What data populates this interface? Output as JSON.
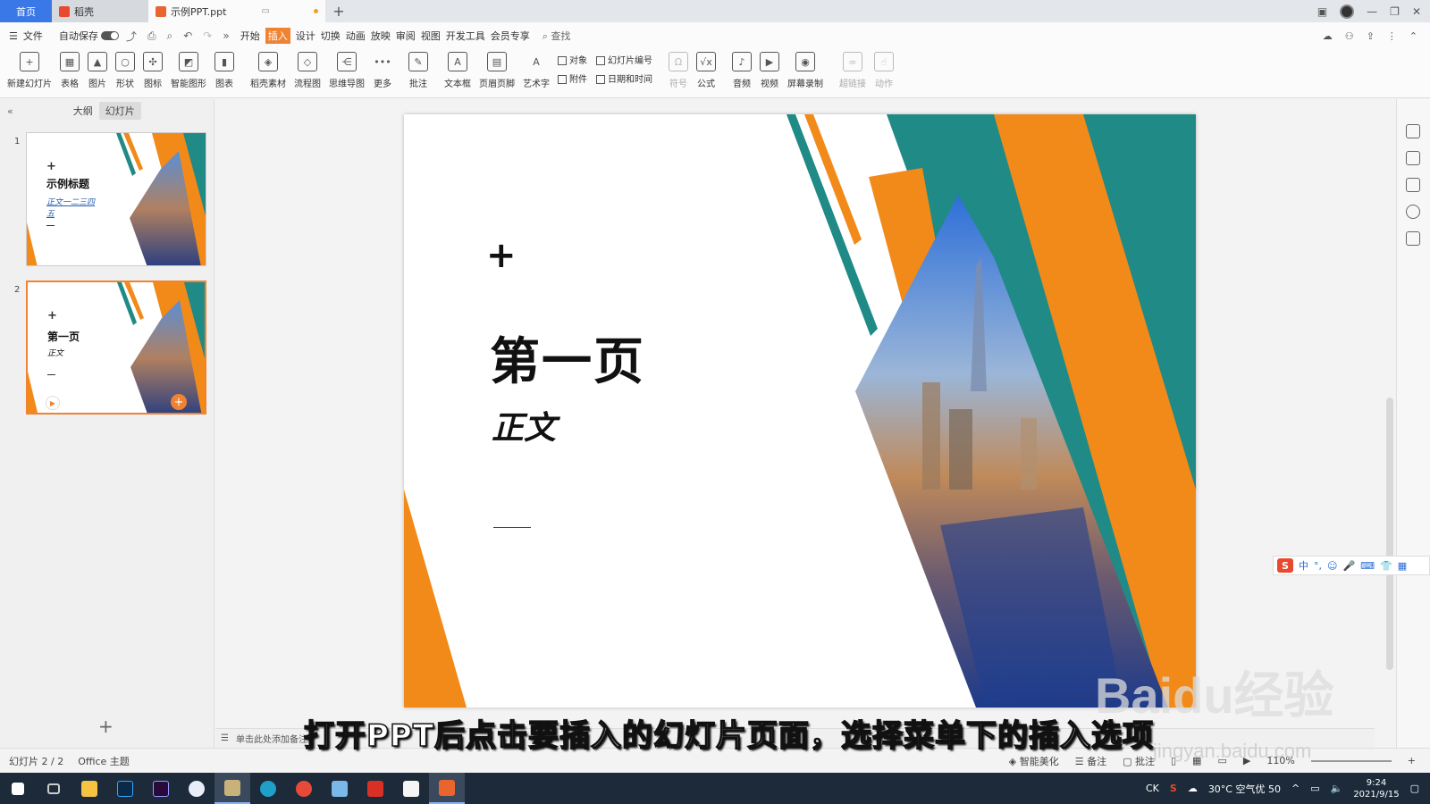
{
  "tabs": {
    "home": "首页",
    "daoke": "稻壳",
    "document": "示例PPT.ppt"
  },
  "menu": {
    "file": "文件",
    "autosave": "自动保存",
    "items": [
      "开始",
      "插入",
      "设计",
      "切换",
      "动画",
      "放映",
      "审阅",
      "视图",
      "开发工具",
      "会员专享"
    ],
    "active_item": "插入",
    "search": "查找"
  },
  "ribbon": {
    "buttons": [
      {
        "label": "新建幻灯片",
        "icon": "new-slide-icon"
      },
      {
        "label": "表格",
        "icon": "table-icon"
      },
      {
        "label": "图片",
        "icon": "picture-icon"
      },
      {
        "label": "形状",
        "icon": "shape-icon"
      },
      {
        "label": "图标",
        "icon": "icons-icon"
      },
      {
        "label": "智能图形",
        "icon": "smartart-icon"
      },
      {
        "label": "图表",
        "icon": "chart-icon"
      },
      {
        "label": "稻壳素材",
        "icon": "material-icon"
      },
      {
        "label": "流程图",
        "icon": "flowchart-icon"
      },
      {
        "label": "思维导图",
        "icon": "mindmap-icon"
      },
      {
        "label": "更多",
        "icon": "more-icon"
      },
      {
        "label": "批注",
        "icon": "comment-icon"
      },
      {
        "label": "文本框",
        "icon": "textbox-icon"
      },
      {
        "label": "页眉页脚",
        "icon": "header-footer-icon"
      },
      {
        "label": "艺术字",
        "icon": "wordart-icon"
      }
    ],
    "pair1": [
      "对象",
      "附件"
    ],
    "pair2": [
      "幻灯片编号",
      "日期和时间"
    ],
    "buttons2": [
      {
        "label": "符号",
        "icon": "symbol-icon",
        "dim": true
      },
      {
        "label": "公式",
        "icon": "formula-icon",
        "dim": false
      },
      {
        "label": "音频",
        "icon": "audio-icon",
        "dim": false
      },
      {
        "label": "视频",
        "icon": "video-icon",
        "dim": false
      },
      {
        "label": "屏幕录制",
        "icon": "screen-record-icon",
        "dim": false
      },
      {
        "label": "超链接",
        "icon": "hyperlink-icon",
        "dim": true
      },
      {
        "label": "动作",
        "icon": "action-icon",
        "dim": true
      }
    ]
  },
  "left_panel": {
    "outline_tab": "大纲",
    "slides_tab": "幻灯片",
    "thumbnails": [
      {
        "num": "1",
        "title": "示例标题",
        "sub": "正文一二三四五",
        "selected": false
      },
      {
        "num": "2",
        "title": "第一页",
        "sub": "正文",
        "selected": true
      }
    ]
  },
  "slide": {
    "plus": "+",
    "title": "第一页",
    "body": "正文"
  },
  "notes_placeholder": "单击此处添加备注",
  "status": {
    "slide_count": "幻灯片 2 / 2",
    "theme": "Office 主题",
    "beautify": "智能美化",
    "notes": "备注",
    "comments": "批注",
    "zoom": "110%"
  },
  "ime": {
    "lang": "中"
  },
  "caption": "打开PPT后点击要插入的幻灯片页面，选择菜单下的插入选项",
  "watermark": {
    "brand": "Baidu经验",
    "url": "jingyan.baidu.com"
  },
  "taskbar": {
    "tray_lang": "CK",
    "weather": "30°C 空气优 50",
    "time": "9:24",
    "date": "2021/9/15"
  },
  "colors": {
    "accent": "#f08234",
    "teal": "#1f8a86",
    "orange": "#f28a1a",
    "blue": "#3b78e7"
  }
}
